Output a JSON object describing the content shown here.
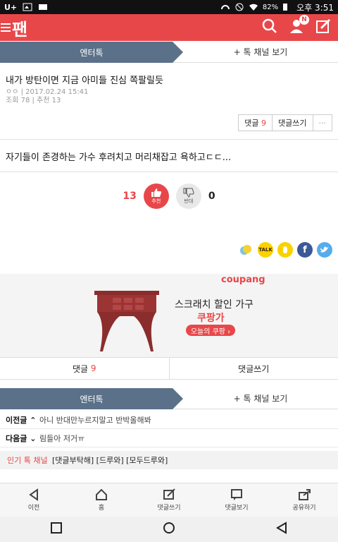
{
  "status": {
    "battery": "82%",
    "time": "오후 3:51",
    "carrier_icon": "U+"
  },
  "app": {
    "logo": "팬",
    "menu_icon": "menu-icon",
    "notif_badge": "N"
  },
  "tab1": {
    "active": "엔터톡",
    "other": "+ 톡 채널 보기"
  },
  "post": {
    "title": "내가 방탄이면 지금 아미들 진심 쪽팔릴듯",
    "author": "ㅇㅇ",
    "date": "2017.02.24 15:41",
    "stats": "조회 78 | 추천 13",
    "comment_label": "댓글",
    "comment_count": "9",
    "write_comment": "댓글쓰기",
    "more": "···",
    "body": "자기들이 존경하는 가수 후려치고 머리채잡고 욕하고ㄷㄷ..."
  },
  "votes": {
    "like_count": "13",
    "like_label": "추천",
    "dislike_count": "0",
    "dislike_label": "반대"
  },
  "share": [
    "kakaostory",
    "TALK",
    "kakaopage",
    "f",
    "twitter"
  ],
  "ad": {
    "brand": "coupang",
    "desc": "스크래치 할인 가구",
    "cat": "쿠팡가",
    "coupon": "오늘의 쿠팡 ›"
  },
  "bottom_actions": {
    "comments": "댓글",
    "comments_count": "9",
    "write": "댓글쓰기"
  },
  "tab2": {
    "active": "엔터톡",
    "other": "+ 톡 채널 보기"
  },
  "prev": {
    "label": "이전글",
    "text": "아니 반대만누르지말고 반박올해봐"
  },
  "next": {
    "label": "다음글",
    "text": "림들아 저거ㅠ"
  },
  "popular": {
    "label": "인기 톡 채널",
    "text": "[댓글부탁해] [드루와] [모두드루와]"
  },
  "botnav": [
    "이전",
    "홈",
    "댓글쓰기",
    "댓글보기",
    "공유하기"
  ]
}
